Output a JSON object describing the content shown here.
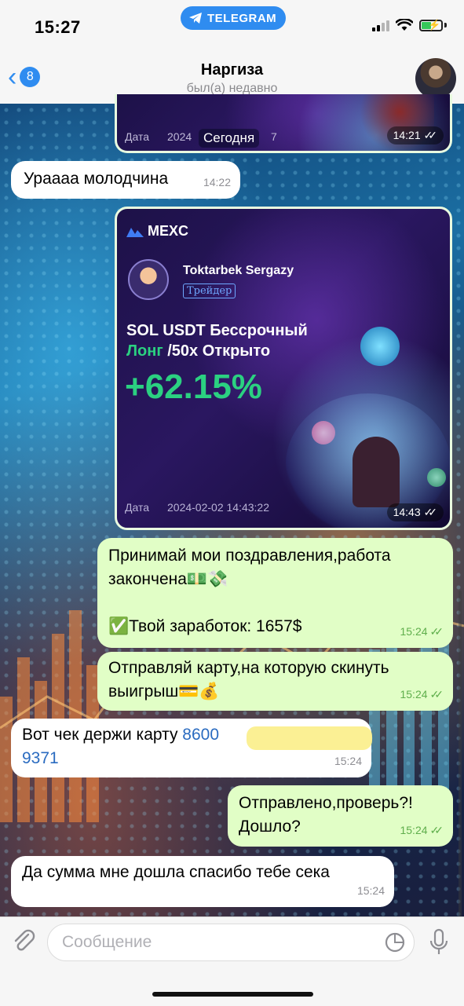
{
  "status_bar": {
    "time": "15:27",
    "app_pill": "TELEGRAM"
  },
  "header": {
    "unread_count": "8",
    "contact_name": "Наргиза",
    "contact_status": "был(а) недавно"
  },
  "messages": {
    "img1": {
      "date_label": "Дата",
      "date_partial": "2024",
      "today_chip": "Сегодня",
      "date_tail": "7",
      "time": "14:21"
    },
    "m1": {
      "text": "Урааaa молодчина",
      "time": "14:22"
    },
    "img2": {
      "brand": "MEXC",
      "trader_name": "Toktarbek Sergazy",
      "trader_tag": "Трейдер",
      "pair_line1": "SOL USDT Бессрочный",
      "pair_long": "Лонг",
      "pair_rest": " /50x Открыто",
      "pnl": "+62.15%",
      "date_label": "Дата",
      "date_value": "2024-02-02 14:43:22",
      "time": "14:43"
    },
    "m2": {
      "line1": "Принимай мои поздравления,работа",
      "line2": "закончена💵💸",
      "line3": "✅Твой заработок: 1657$",
      "time": "15:24"
    },
    "m3": {
      "line1": "Отправляй карту,на которую скинуть",
      "line2": "выигрыш💳💰",
      "time": "15:24"
    },
    "m4": {
      "prefix": "Вот чек держи карту ",
      "card_start": "8600",
      "card_end": "9371",
      "time": "15:24"
    },
    "m5": {
      "line1": "Отправлено,проверь?!",
      "line2": "Дошло?",
      "time": "15:24"
    },
    "m6": {
      "text": "Да сумма мне дошла спасибо тебе сека",
      "time": "15:24"
    }
  },
  "composer": {
    "placeholder": "Сообщение"
  },
  "colors": {
    "accent": "#2f8cf0",
    "outgoing_bubble": "#e1fec6",
    "incoming_bubble": "#ffffff",
    "profit_green": "#2bd181"
  },
  "icons": [
    "telegram-icon",
    "signal-icon",
    "wifi-icon",
    "battery-icon",
    "back-chevron-icon",
    "double-check-icon",
    "attach-icon",
    "sticker-icon",
    "microphone-icon"
  ]
}
